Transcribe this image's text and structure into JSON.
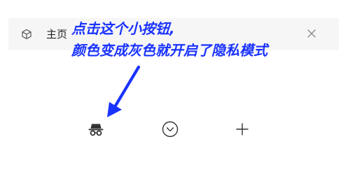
{
  "tab": {
    "title": "主页",
    "icon": "cube-icon",
    "close_icon": "close-icon"
  },
  "annotation": {
    "line1": "点击这个小按钮,",
    "line2": "颜色变成灰色就开启了隐私模式",
    "color": "#1a33ff"
  },
  "controls": {
    "incognito_icon": "incognito-icon",
    "dropdown_icon": "chevron-circle-icon",
    "add_icon": "plus-icon"
  },
  "colors": {
    "tab_background": "#f6f6f6",
    "icon": "#333333",
    "annotation": "#1a33ff"
  }
}
